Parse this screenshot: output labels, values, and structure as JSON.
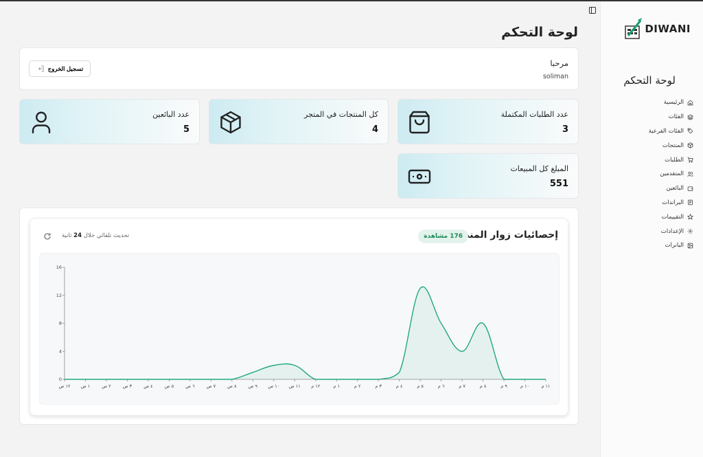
{
  "sidebar": {
    "logo_text": "DIWANI",
    "title": "لوحة التحكم",
    "items": [
      {
        "label": "الرئيسية",
        "icon": "home-icon"
      },
      {
        "label": "الفئات",
        "icon": "layers-icon"
      },
      {
        "label": "الفئات الفرعية",
        "icon": "tag-icon"
      },
      {
        "label": "المنتجات",
        "icon": "box-icon"
      },
      {
        "label": "الطلبات",
        "icon": "cart-icon"
      },
      {
        "label": "المتقدمين",
        "icon": "users-icon"
      },
      {
        "label": "البائعين",
        "icon": "wallet-icon"
      },
      {
        "label": "البراندات",
        "icon": "brand-icon"
      },
      {
        "label": "التقييمات",
        "icon": "star-icon"
      },
      {
        "label": "الإعدادات",
        "icon": "gear-icon"
      },
      {
        "label": "البانرات",
        "icon": "image-icon"
      }
    ]
  },
  "header": {
    "title": "لوحة التحكم"
  },
  "welcome": {
    "greeting": "مرحبا",
    "username": "soliman",
    "logout_label": "تسجيل الخروج"
  },
  "stats": {
    "completed_orders": {
      "label": "عدد الطلبات المكتملة",
      "value": "3",
      "icon": "shopping-bag-icon"
    },
    "products": {
      "label": "كل المنتجات في المتجر",
      "value": "4",
      "icon": "package-icon"
    },
    "sellers": {
      "label": "عدد البائعين",
      "value": "5",
      "icon": "user-icon"
    },
    "sales_total": {
      "label": "المبلغ كل المبيعات",
      "value": "551",
      "icon": "banknote-icon"
    }
  },
  "visitors": {
    "title": "إحصائيات زوار المنصة",
    "views_badge": "176 مشاهدة",
    "refresh_prefix": "تحديث تلقائي خلال ",
    "refresh_seconds": "24",
    "refresh_suffix": " ثانية"
  },
  "colors": {
    "accent": "#1fa97a",
    "badge_bg": "#e3f3ec",
    "badge_text": "#1f8a5a"
  },
  "chart_data": {
    "type": "area",
    "x": [
      "١٢ ص",
      "١ ص",
      "٢ ص",
      "٣ ص",
      "٤ ص",
      "٥ ص",
      "٦ ص",
      "٧ ص",
      "٨ ص",
      "٩ ص",
      "١٠ ص",
      "١١ ص",
      "١٢ م",
      "١ م",
      "٢ م",
      "٣ م",
      "٤ م",
      "٥ م",
      "٦ م",
      "٧ م",
      "٨ م",
      "٩ م",
      "١٠ م",
      "١١ م"
    ],
    "series": [
      {
        "values": [
          0,
          0,
          0,
          0,
          0,
          0,
          0,
          0,
          0,
          1,
          2,
          2,
          0,
          0,
          0,
          0,
          1,
          13,
          8,
          4,
          8,
          0,
          0,
          0
        ]
      }
    ],
    "yticks": [
      0,
      4,
      8,
      12,
      16
    ],
    "ylim": [
      0,
      16
    ],
    "grid": false
  }
}
